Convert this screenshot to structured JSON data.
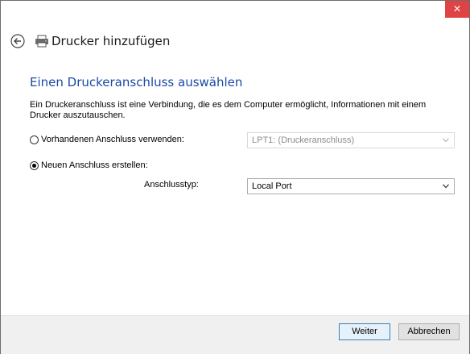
{
  "window": {
    "close_glyph": "✕",
    "header_title": "Drucker hinzufügen"
  },
  "content": {
    "section_title": "Einen Druckeranschluss auswählen",
    "intro": "Ein Druckeranschluss ist eine Verbindung, die es dem Computer ermöglicht, Informationen mit einem Drucker auszutauschen.",
    "existing_port": {
      "label": "Vorhandenen Anschluss verwenden:",
      "checked": false,
      "selected_value": "LPT1: (Druckeranschluss)",
      "disabled": true
    },
    "new_port": {
      "label": "Neuen Anschluss erstellen:",
      "checked": true,
      "port_type_label": "Anschlusstyp:",
      "port_type_value": "Local Port"
    }
  },
  "footer": {
    "next_label": "Weiter",
    "cancel_label": "Abbrechen"
  },
  "colors": {
    "accent_title": "#1a4aa6",
    "close_button": "#e04343"
  }
}
